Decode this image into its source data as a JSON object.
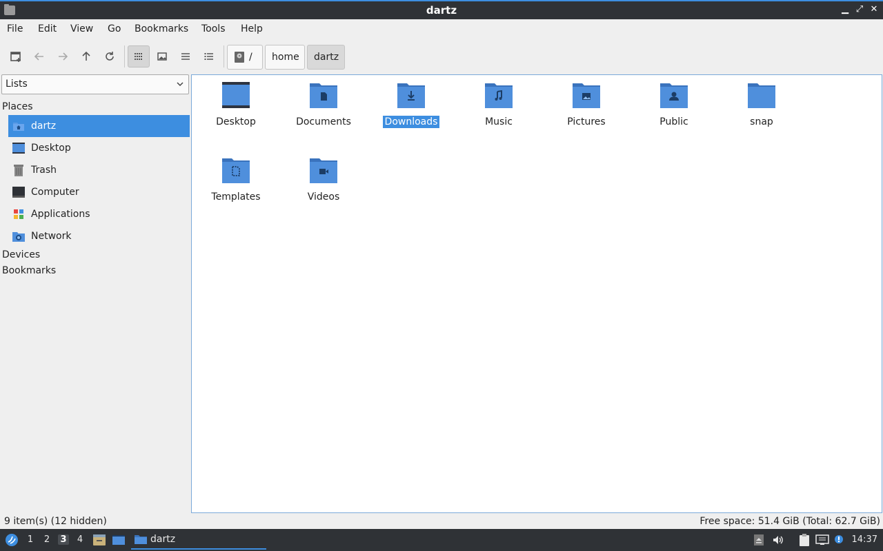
{
  "window": {
    "title": "dartz",
    "minimize": "▁",
    "maximize": "⤢",
    "close": "✕"
  },
  "menu": [
    "File",
    "Edit",
    "View",
    "Go",
    "Bookmarks",
    "Tools",
    "Help"
  ],
  "toolbar": {
    "buttons": [
      "new-tab-icon",
      "back-icon",
      "forward-icon",
      "up-icon",
      "reload-icon",
      "icon-view-icon",
      "thumbnail-view-icon",
      "compact-view-icon",
      "detailed-list-icon"
    ],
    "breadcrumb": {
      "root": "/",
      "items": [
        "home",
        "dartz"
      ]
    }
  },
  "sidebar": {
    "mode": "Lists",
    "places_header": "Places",
    "places": [
      {
        "label": "dartz",
        "icon": "home-folder-icon",
        "selected": true
      },
      {
        "label": "Desktop",
        "icon": "desktop-icon"
      },
      {
        "label": "Trash",
        "icon": "trash-icon"
      },
      {
        "label": "Computer",
        "icon": "computer-icon"
      },
      {
        "label": "Applications",
        "icon": "applications-icon"
      },
      {
        "label": "Network",
        "icon": "network-icon"
      }
    ],
    "devices_header": "Devices",
    "bookmarks_header": "Bookmarks"
  },
  "files": [
    {
      "name": "Desktop",
      "icon": "desktop-folder-icon"
    },
    {
      "name": "Documents",
      "icon": "documents-folder-icon"
    },
    {
      "name": "Downloads",
      "icon": "downloads-folder-icon",
      "selected": true
    },
    {
      "name": "Music",
      "icon": "music-folder-icon"
    },
    {
      "name": "Pictures",
      "icon": "pictures-folder-icon"
    },
    {
      "name": "Public",
      "icon": "public-folder-icon"
    },
    {
      "name": "snap",
      "icon": "folder-icon"
    },
    {
      "name": "Templates",
      "icon": "templates-folder-icon"
    },
    {
      "name": "Videos",
      "icon": "videos-folder-icon"
    }
  ],
  "status": {
    "left": "9 item(s) (12 hidden)",
    "right": "Free space: 51.4 GiB (Total: 62.7 GiB)"
  },
  "taskbar": {
    "workspaces": [
      "1",
      "2",
      "3",
      "4"
    ],
    "active_workspace": "3",
    "task_label": "dartz",
    "clock": "14:37"
  },
  "colors": {
    "accent": "#3d8ee0",
    "folder": "#4f8fdc",
    "folder_dark": "#3a73bd",
    "titlebar": "#2f3236"
  }
}
